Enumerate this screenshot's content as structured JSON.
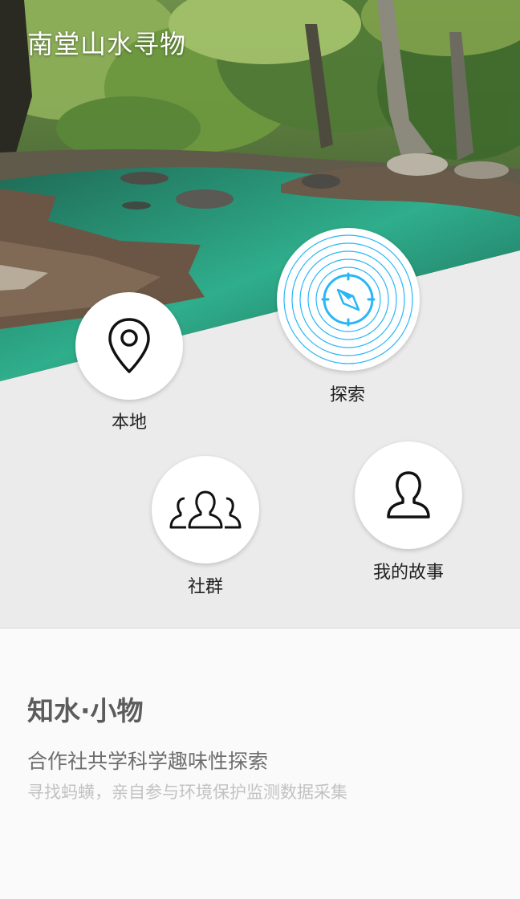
{
  "app": {
    "title": "南堂山水寻物"
  },
  "menu": {
    "local": {
      "label": "本地",
      "icon": "map-pin-icon"
    },
    "explore": {
      "label": "探索",
      "icon": "compass-icon",
      "accent": "#29b6f6"
    },
    "group": {
      "label": "社群",
      "icon": "people-group-icon"
    },
    "story": {
      "label": "我的故事",
      "icon": "person-icon"
    }
  },
  "info": {
    "title": "知水·小物",
    "subtitle": "合作社共学科学趣味性探索",
    "description": "寻找蚂蟥，亲自参与环境保护监测数据采集"
  }
}
